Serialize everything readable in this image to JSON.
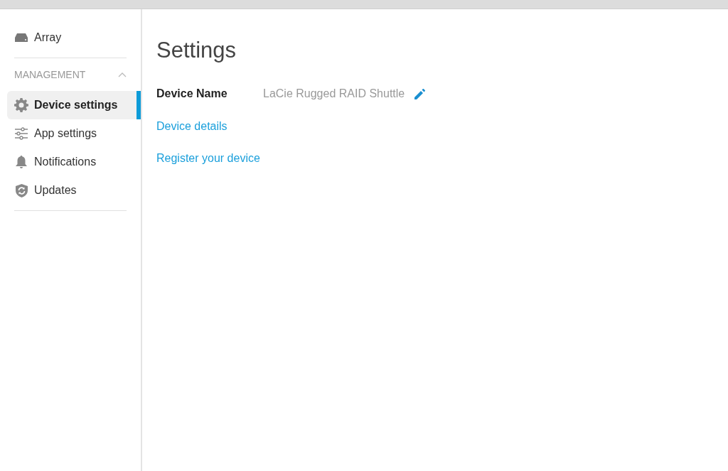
{
  "sidebar": {
    "top_item": {
      "label": "Array",
      "selected": false
    },
    "section": {
      "title": "MANAGEMENT",
      "expanded": true,
      "items": [
        {
          "label": "Device settings",
          "selected": true
        },
        {
          "label": "App settings",
          "selected": false
        },
        {
          "label": "Notifications",
          "selected": false
        },
        {
          "label": "Updates",
          "selected": false
        }
      ]
    }
  },
  "main": {
    "title": "Settings",
    "device_name": {
      "label": "Device Name",
      "value": "LaCie Rugged RAID Shuttle"
    },
    "links": [
      "Device details",
      "Register your device"
    ]
  }
}
